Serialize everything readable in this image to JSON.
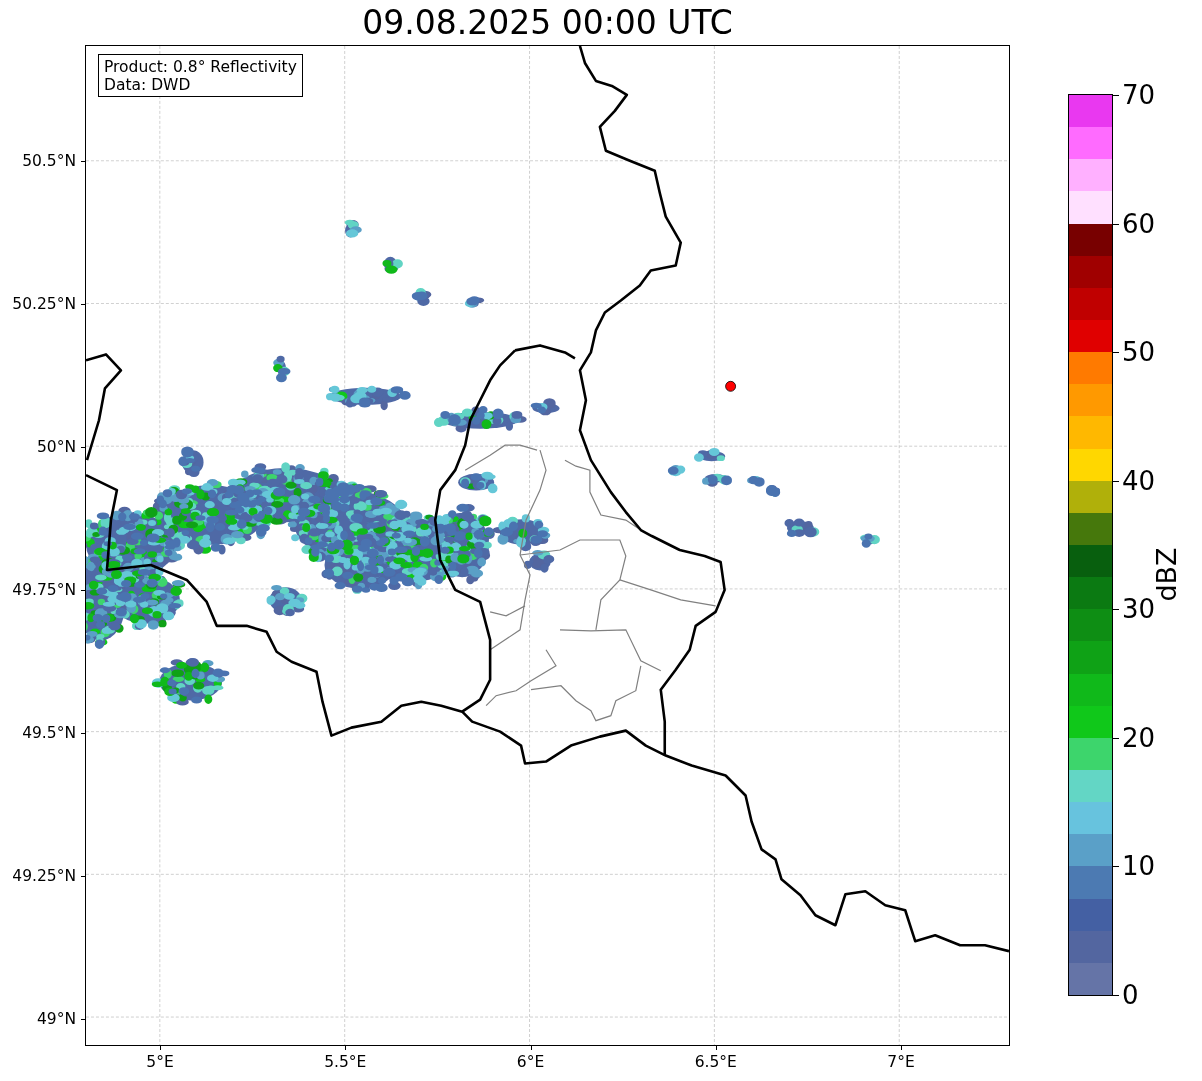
{
  "title": "09.08.2025 00:00 UTC",
  "info_box": {
    "lines": [
      "Product: 0.8° Reflectivity",
      "Data: DWD"
    ]
  },
  "map": {
    "y_ticks": [
      "50.5°N",
      "50.25°N",
      "50°N",
      "49.75°N",
      "49.5°N",
      "49.25°N",
      "49°N"
    ],
    "x_ticks": [
      "5°E",
      "5.5°E",
      "6°E",
      "6.5°E",
      "7°E"
    ]
  },
  "colorbar": {
    "label": "dBZ",
    "ticks": [
      "70",
      "60",
      "50",
      "40",
      "30",
      "20",
      "10",
      "0"
    ],
    "segments": [
      {
        "color": "#e938f0"
      },
      {
        "color": "#ff6bff"
      },
      {
        "color": "#ffb0ff"
      },
      {
        "color": "#ffe0ff"
      },
      {
        "color": "#780000"
      },
      {
        "color": "#a00000"
      },
      {
        "color": "#c00000"
      },
      {
        "color": "#e00000"
      },
      {
        "color": "#ff7a00"
      },
      {
        "color": "#ff9900"
      },
      {
        "color": "#ffb800"
      },
      {
        "color": "#ffd700"
      },
      {
        "color": "#b0b00a"
      },
      {
        "color": "#46780c"
      },
      {
        "color": "#085f0e"
      },
      {
        "color": "#0b7a12"
      },
      {
        "color": "#0e8e14"
      },
      {
        "color": "#0fa216"
      },
      {
        "color": "#10b91a"
      },
      {
        "color": "#10c81a"
      },
      {
        "color": "#3dd56c"
      },
      {
        "color": "#63d6c5"
      },
      {
        "color": "#67c3de"
      },
      {
        "color": "#5aa0c8"
      },
      {
        "color": "#4c7ab2"
      },
      {
        "color": "#4460a3"
      },
      {
        "color": "#5366a0"
      },
      {
        "color": "#6574a7"
      }
    ]
  }
}
